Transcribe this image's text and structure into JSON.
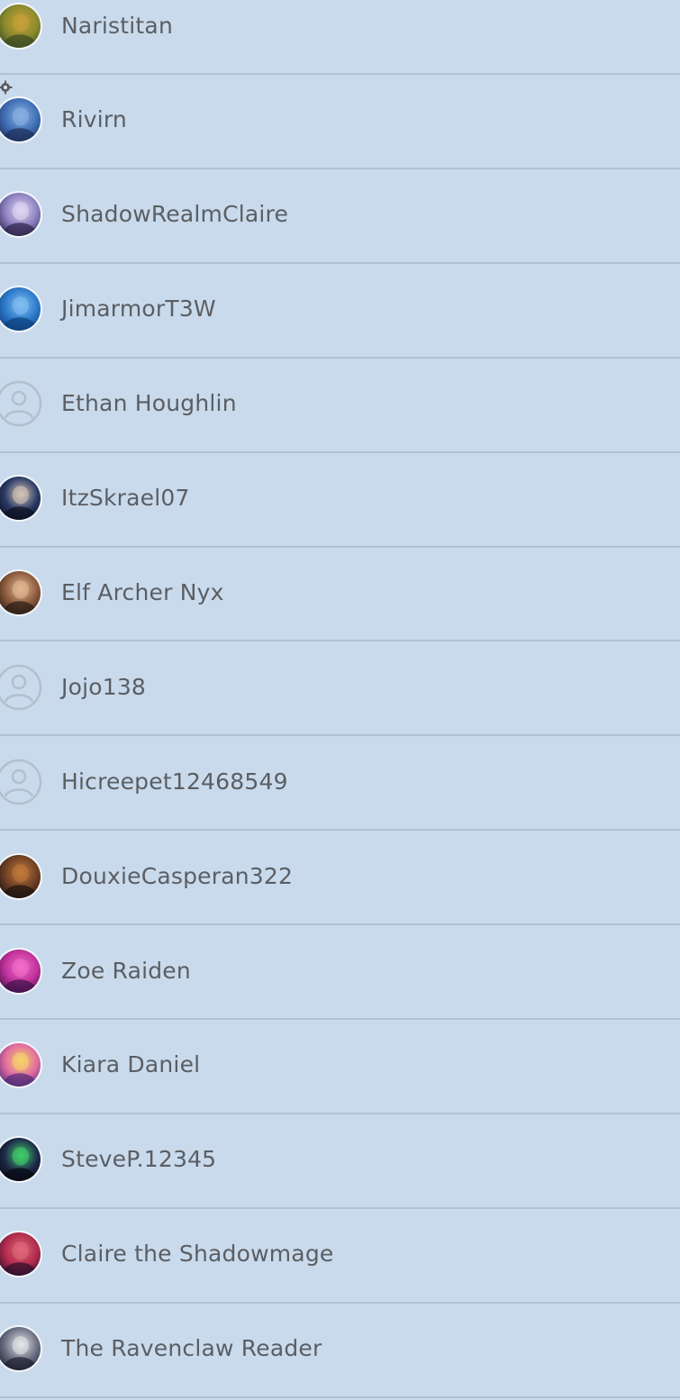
{
  "users": [
    {
      "name": "Naristitan",
      "avatar": "photo",
      "colors": [
        "#3a4a22",
        "#8a8a2c",
        "#c9a13a"
      ]
    },
    {
      "name": "Rivirn",
      "avatar": "photo",
      "colors": [
        "#1e2f58",
        "#3f6eb5",
        "#8ab3e3"
      ]
    },
    {
      "name": "ShadowRealmClaire",
      "avatar": "photo",
      "colors": [
        "#2b2247",
        "#8b7fbf",
        "#e0d8f2"
      ]
    },
    {
      "name": "JimarmorT3W",
      "avatar": "photo",
      "colors": [
        "#0d3f7a",
        "#2c78c9",
        "#83c0f2"
      ]
    },
    {
      "name": "Ethan Houghlin",
      "avatar": "placeholder",
      "colors": []
    },
    {
      "name": "ItzSkrael07",
      "avatar": "photo",
      "colors": [
        "#0b0f1f",
        "#2b3b66",
        "#d6c6b7"
      ]
    },
    {
      "name": "Elf Archer Nyx",
      "avatar": "photo",
      "colors": [
        "#2a1c16",
        "#8b5a3c",
        "#e3b994"
      ]
    },
    {
      "name": "Jojo138",
      "avatar": "placeholder",
      "colors": []
    },
    {
      "name": "Hicreepet12468549",
      "avatar": "placeholder",
      "colors": []
    },
    {
      "name": "DouxieCasperan322",
      "avatar": "photo",
      "colors": [
        "#1b120e",
        "#6d3f24",
        "#c07a3c"
      ]
    },
    {
      "name": "Zoe Raiden",
      "avatar": "photo",
      "colors": [
        "#3a1347",
        "#c0309b",
        "#f070c8"
      ]
    },
    {
      "name": "Kiara Daniel",
      "avatar": "photo",
      "colors": [
        "#4b2a78",
        "#e06aa0",
        "#f6d36a"
      ]
    },
    {
      "name": "SteveP.12345",
      "avatar": "photo",
      "colors": [
        "#07080f",
        "#1e2a4a",
        "#3fd06a"
      ]
    },
    {
      "name": "Claire the Shadowmage",
      "avatar": "photo",
      "colors": [
        "#2a0f2c",
        "#b02a4c",
        "#e06a7a"
      ]
    },
    {
      "name": "The Ravenclaw Reader",
      "avatar": "photo",
      "colors": [
        "#1c1f2e",
        "#6b6f82",
        "#e5e6ea"
      ]
    }
  ],
  "placeholder_color": "#b3bfcc"
}
